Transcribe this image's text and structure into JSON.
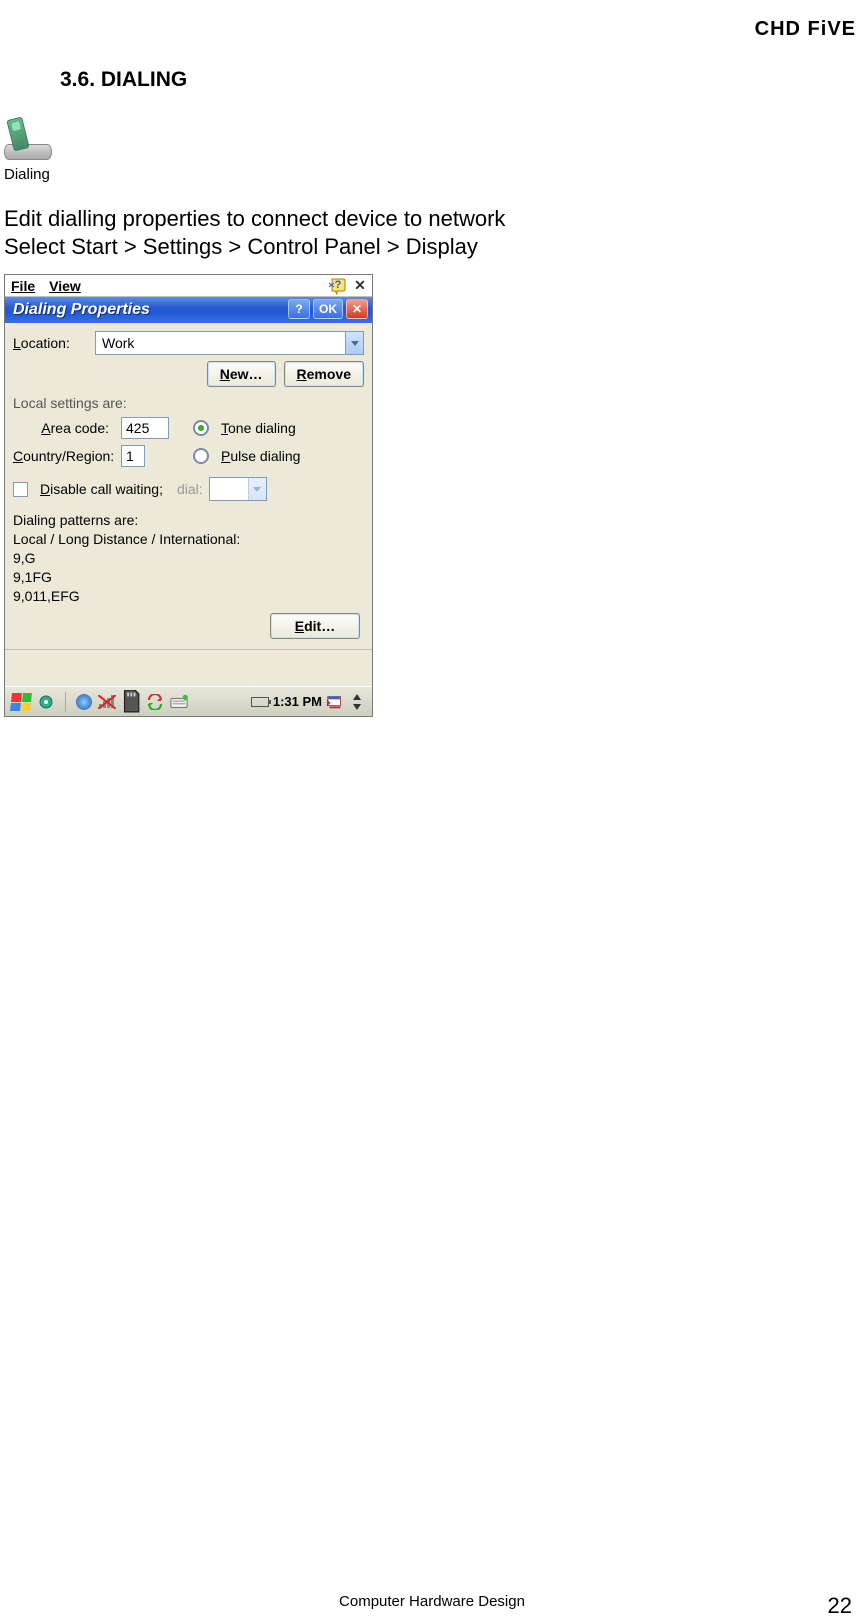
{
  "header": {
    "brand": "CHD FiVE"
  },
  "section": {
    "number": "3.6. ",
    "title_cap": "D",
    "title_rest": "IALING"
  },
  "desktop_icon_label": "Dialing",
  "body_lines": {
    "l1": "Edit dialling properties to connect device to network",
    "l2": "Select Start > Settings > Control Panel > Display"
  },
  "window": {
    "menu": {
      "file": "File",
      "view": "View"
    },
    "title": "Dialing Properties",
    "titlebar_buttons": {
      "help": "?",
      "ok": "OK",
      "close": "✕"
    },
    "location_label_pre": "L",
    "location_label_post": "ocation:",
    "location_value": "Work",
    "new_btn_pre": "N",
    "new_btn_post": "ew…",
    "remove_btn_pre": "R",
    "remove_btn_post": "emove",
    "local_settings_label": "Local settings are:",
    "area_code_label_pre": "A",
    "area_code_label_post": "rea code:",
    "area_code_value": "425",
    "country_label_pre": "C",
    "country_label_post": "ountry/Region:",
    "country_value": "1",
    "tone_pre": "T",
    "tone_post": "one dialing",
    "pulse_pre": "P",
    "pulse_post": "ulse dialing",
    "disable_pre": "D",
    "disable_post": "isable call waiting;",
    "dial_label": "dial:",
    "patterns_heading": "Dialing patterns are:",
    "patterns_sub": "Local / Long Distance / International:",
    "p1": "9,G",
    "p2": "9,1FG",
    "p3": "9,011,EFG",
    "edit_pre": "E",
    "edit_post": "dit…",
    "clock": "1:31 PM"
  },
  "footer": {
    "center": "Computer Hardware Design",
    "page": "22"
  }
}
